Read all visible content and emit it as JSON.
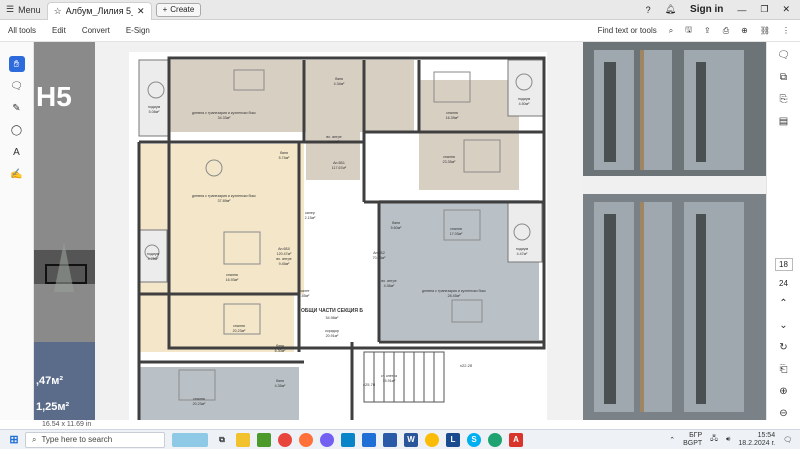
{
  "titlebar": {
    "menu_label": "Menu",
    "tab_title": "Албум_Лилия 5_05.10...",
    "create_label": "Create",
    "signin_label": "Sign in"
  },
  "menubar": {
    "items": [
      "All tools",
      "Edit",
      "Convert",
      "E-Sign"
    ],
    "find_label": "Find text or tools"
  },
  "left_page": {
    "logo_text": "H5",
    "area1": ",47м²",
    "area2": "1,25м²"
  },
  "plan": {
    "labels": {
      "podium1": "подиум",
      "podium1_area": "5.08м²",
      "living1": "дневна с трапезария и кухненски бокс",
      "living1_area": "34.33м²",
      "bath1": "баня",
      "bath1_area": "4.34м²",
      "bedroom1": "спалня",
      "bedroom1_area": "16.39м²",
      "podium2": "подиум",
      "podium2_area": "4.50м²",
      "corridor1": "вх. антре",
      "corridor1_area": "9.30м²",
      "apt1": "Ап.6Б1",
      "apt1_area": "117.67м²",
      "bedroom2": "спалня",
      "bedroom2_area": "23.35м²",
      "living2": "дневна с трапезария и кухненски бокс",
      "living2_area": "37.89м²",
      "bath2": "баня",
      "bath2_area": "5.74м²",
      "storage1": "килер",
      "storage1_area": "2.15м²",
      "apt2": "Ап.6Б0",
      "apt2_area": "120.47м²",
      "corridor2": "вх. антре",
      "corridor2_area": "9.45м²",
      "bedroom3": "спалня",
      "bedroom3_area": "16.93м²",
      "podium3": "подиум",
      "podium3_area": "4.75м²",
      "wc": "тоалет",
      "wc_area": "3.55м²",
      "bath3": "баня",
      "bath3_area": "5.60м²",
      "bedroom4": "спалня",
      "bedroom4_area": "17.03м²",
      "podium4": "подиум",
      "podium4_area": "4.47м²",
      "apt3": "Ап.6Б2",
      "apt3_area": "70.23м²",
      "corridor3": "вх. антре",
      "corridor3_area": "4.36м²",
      "living3": "дневна с трапезария и кухненски бокс",
      "living3_area": "28.45м²",
      "common": "ОБЩИ ЧАСТИ СЕКЦИЯ Б",
      "common_area": "54.98м²",
      "corridor_c": "коридор",
      "corridor_c_area": "20.91м²",
      "bedroom5": "спалня",
      "bedroom5_area": "20.23м²",
      "bath4": "баня",
      "bath4_area": "6.30м²",
      "bath5": "баня",
      "bath5_area": "4.35м²",
      "stair": "ст. клетка",
      "stair_area": "15.91м²",
      "elev_mark1": "±22.2б",
      "elev_mark2": "±25.7б",
      "bedroom6": "спалня",
      "bedroom6_area": "20.23м²",
      "bedroom7": "спалня",
      "bedroom7_area": "16.93м²"
    }
  },
  "rightbar": {
    "page_current": "18",
    "page_total": "24"
  },
  "statusbar": {
    "page_size": "16.54 x 11.69 in"
  },
  "taskbar": {
    "search_placeholder": "Type here to search",
    "lang1": "БГР",
    "lang2": "BGPT",
    "time": "15:54",
    "date": "18.2.2024 г."
  },
  "colors": {
    "accent_blue": "#2d6bdc",
    "plan_beige": "#d8cfc3",
    "plan_cream": "#f3e6c9",
    "plan_gray": "#b9c1c6",
    "wall": "#3f3f3f",
    "acrobat_red": "#d9342b"
  }
}
